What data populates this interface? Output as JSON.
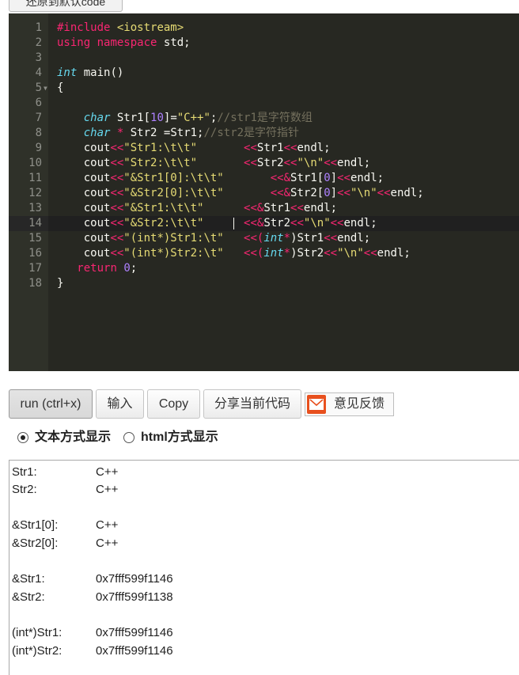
{
  "top_button": {
    "label": "还原到默认code"
  },
  "editor": {
    "line_numbers": [
      "1",
      "2",
      "3",
      "4",
      "5",
      "6",
      "7",
      "8",
      "9",
      "10",
      "11",
      "12",
      "13",
      "14",
      "15",
      "16",
      "17",
      "18"
    ],
    "active_line": "14",
    "code": {
      "l1_a": "#include",
      "l1_b": "<iostream>",
      "l2_a": "using",
      "l2_b": "namespace",
      "l2_c": "std;",
      "l4_a": "int",
      "l4_b": "main()",
      "l5_a": "{",
      "l7_a": "char",
      "l7_b": "Str1[",
      "l7_c": "10",
      "l7_d": "]=",
      "l7_e": "\"C++\"",
      "l7_f": ";",
      "l7_g": "//str1是字符数组",
      "l8_a": "char",
      "l8_b": "*",
      "l8_c": "Str2",
      "l8_d": "=Str1;",
      "l8_e": "//str2是字符指针",
      "l9_a": "cout",
      "l9_b": "<<",
      "l9_c": "\"Str1:\\t\\t\"",
      "l9_d": "<<",
      "l9_e": "Str1",
      "l9_f": "<<",
      "l9_g": "endl;",
      "l10_a": "cout",
      "l10_b": "<<",
      "l10_c": "\"Str2:\\t\\t\"",
      "l10_d": "<<",
      "l10_e": "Str2",
      "l10_f": "<<",
      "l10_g": "\"\\n\"",
      "l10_h": "<<",
      "l10_i": "endl;",
      "l11_a": "cout",
      "l11_b": "<<",
      "l11_c": "\"&Str1[0]:\\t\\t\"",
      "l11_d": "<<&",
      "l11_e": "Str1[",
      "l11_f": "0",
      "l11_g": "]",
      "l11_h": "<<",
      "l11_i": "endl;",
      "l12_a": "cout",
      "l12_b": "<<",
      "l12_c": "\"&Str2[0]:\\t\\t\"",
      "l12_d": "<<&",
      "l12_e": "Str2[",
      "l12_f": "0",
      "l12_g": "]",
      "l12_h": "<<",
      "l12_i": "\"\\n\"",
      "l12_j": "<<",
      "l12_k": "endl;",
      "l13_a": "cout",
      "l13_b": "<<",
      "l13_c": "\"&Str1:\\t\\t\"",
      "l13_d": "<<&",
      "l13_e": "Str1",
      "l13_f": "<<",
      "l13_g": "endl;",
      "l14_a": "cout",
      "l14_b": "<<",
      "l14_c": "\"&Str2:\\t\\t\"",
      "l14_d": "<<&",
      "l14_e": "Str2",
      "l14_f": "<<",
      "l14_g": "\"\\n\"",
      "l14_h": "<<",
      "l14_i": "endl;",
      "l15_a": "cout",
      "l15_b": "<<",
      "l15_c": "\"(int*)Str1:\\t\"",
      "l15_d": "<<(",
      "l15_e": "int",
      "l15_f": "*",
      "l15_g": ")Str1",
      "l15_h": "<<",
      "l15_i": "endl;",
      "l16_a": "cout",
      "l16_b": "<<",
      "l16_c": "\"(int*)Str2:\\t\"",
      "l16_d": "<<(",
      "l16_e": "int",
      "l16_f": "*",
      "l16_g": ")Str2",
      "l16_h": "<<",
      "l16_i": "\"\\n\"",
      "l16_j": "<<",
      "l16_k": "endl;",
      "l17_a": "return",
      "l17_b": "0",
      "l17_c": ";",
      "l18_a": "}"
    }
  },
  "toolbar": {
    "run_label": "run (ctrl+x)",
    "input_label": "输入",
    "copy_label": "Copy",
    "share_label": "分享当前代码",
    "feedback_label": "意见反馈"
  },
  "display_mode": {
    "text_label": "文本方式显示",
    "html_label": "html方式显示",
    "selected": "text"
  },
  "output": {
    "rows": [
      {
        "label": "Str1:",
        "value": "C++"
      },
      {
        "label": "Str2:",
        "value": "C++"
      },
      {
        "label": "&Str1[0]:",
        "value": "C++"
      },
      {
        "label": "&Str2[0]:",
        "value": "C++"
      },
      {
        "label": "&Str1:",
        "value": "0x7fff599f1146"
      },
      {
        "label": "&Str2:",
        "value": "0x7fff599f1138"
      },
      {
        "label": "(int*)Str1:",
        "value": "0x7fff599f1146"
      },
      {
        "label": "(int*)Str2:",
        "value": "0x7fff599f1146"
      }
    ]
  },
  "colors": {
    "editor_bg": "#272822",
    "keyword": "#f92672",
    "type": "#66d9ef",
    "string": "#e6db74",
    "number": "#ae81ff",
    "comment": "#75715e",
    "feedback_icon": "#e8501e"
  },
  "icons": {
    "feedback": "mail-icon",
    "fold": "fold-arrow-icon"
  }
}
